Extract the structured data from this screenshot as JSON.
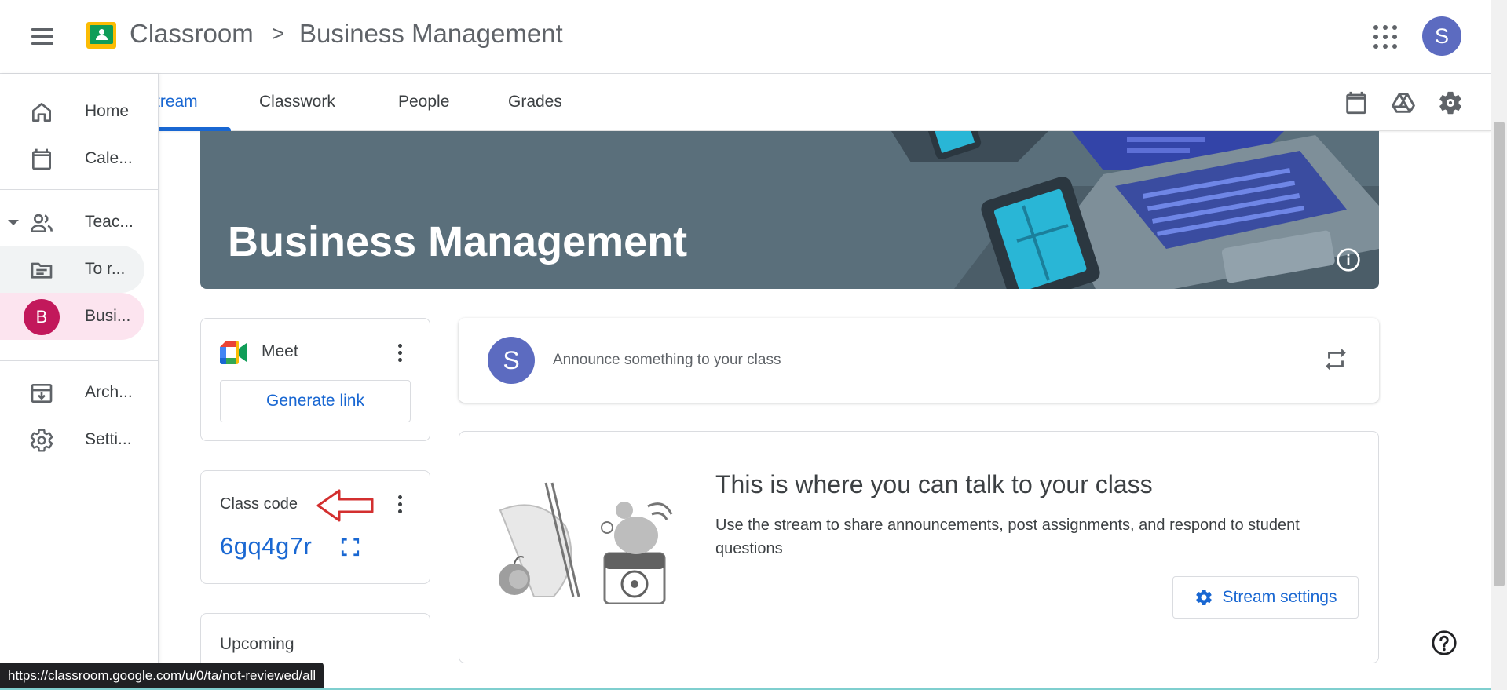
{
  "header": {
    "app_name": "Classroom",
    "separator": ">",
    "class_name": "Business Management",
    "avatar_letter": "S"
  },
  "tabs": [
    {
      "label": "tream",
      "active": true
    },
    {
      "label": "Classwork",
      "active": false
    },
    {
      "label": "People",
      "active": false
    },
    {
      "label": "Grades",
      "active": false
    }
  ],
  "sidebar": {
    "items": [
      {
        "label": "Home",
        "icon": "home-icon"
      },
      {
        "label": "Cale...",
        "icon": "calendar-icon"
      },
      {
        "label": "Teac...",
        "icon": "people-icon"
      },
      {
        "label": "To r...",
        "icon": "folder-icon"
      },
      {
        "label": "Busi...",
        "avatar_letter": "B"
      },
      {
        "label": "Arch...",
        "icon": "archive-icon"
      },
      {
        "label": "Setti...",
        "icon": "gear-icon"
      }
    ]
  },
  "banner": {
    "title": "Business Management"
  },
  "meet": {
    "label": "Meet",
    "button": "Generate link"
  },
  "class_code": {
    "label": "Class code",
    "value": "6gq4g7r"
  },
  "upcoming": {
    "label": "Upcoming"
  },
  "announce": {
    "avatar_letter": "S",
    "placeholder": "Announce something to your class"
  },
  "talk": {
    "title": "This is where you can talk to your class",
    "description": "Use the stream to share announcements, post assignments, and respond to student questions",
    "button": "Stream settings"
  },
  "status_url": "https://classroom.google.com/u/0/ta/not-reviewed/all",
  "colors": {
    "accent": "#1967d2",
    "banner": "#5a6f7b",
    "avatar": "#5c6bc0",
    "class_avatar": "#c2185b",
    "annotation_arrow": "#d32f2f"
  }
}
